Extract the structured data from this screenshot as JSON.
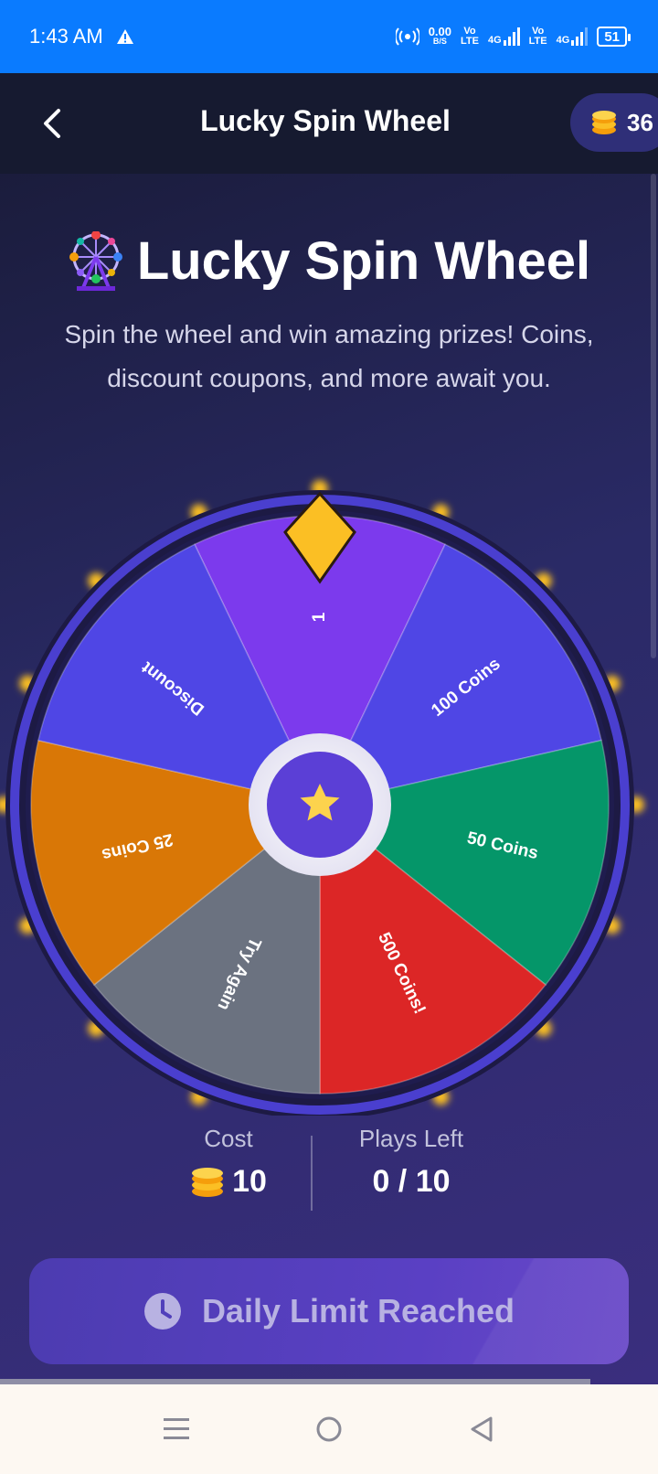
{
  "status_bar": {
    "time": "1:43 AM",
    "net_speed_value": "0.00",
    "net_speed_unit": "B/S",
    "sim1_top": "Vo",
    "sim1_bottom": "LTE",
    "sim1_net": "4G",
    "sim2_top": "Vo",
    "sim2_bottom": "LTE",
    "sim2_net": "4G",
    "battery": "51"
  },
  "header": {
    "title": "Lucky Spin Wheel",
    "coins": "36"
  },
  "hero": {
    "icon": "ferris-wheel-icon",
    "title": "Lucky Spin Wheel",
    "subtitle": "Spin the wheel and win amazing prizes! Coins, discount coupons, and more await you."
  },
  "wheel": {
    "segments": [
      {
        "label": "1",
        "color": "#7c3aed"
      },
      {
        "label": "100 Coins",
        "color": "#4f46e5"
      },
      {
        "label": "50 Coins",
        "color": "#059669"
      },
      {
        "label": "500 Coins!",
        "color": "#dc2626"
      },
      {
        "label": "Try Again",
        "color": "#6b7280"
      },
      {
        "label": "25 Coins",
        "color": "#d97706"
      },
      {
        "label": "Discount",
        "color": "#4f46e5"
      }
    ],
    "rim_color": "#4a3fcf",
    "pointer_color": "#fbbf24",
    "center_color": "#5b3fd6",
    "center_icon": "star-icon"
  },
  "stats": {
    "cost_label": "Cost",
    "cost_value": "10",
    "plays_label": "Plays Left",
    "plays_value": "0 / 10"
  },
  "action": {
    "label": "Daily Limit Reached",
    "icon": "clock-icon"
  }
}
